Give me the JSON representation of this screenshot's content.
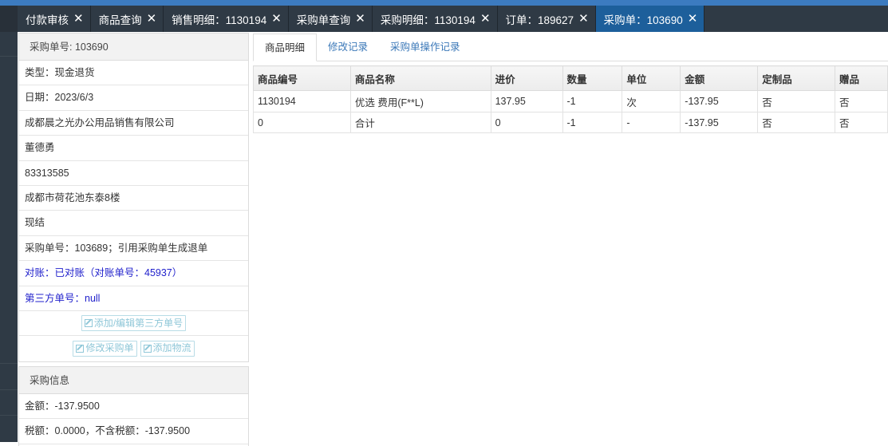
{
  "tabs": [
    {
      "label": "付款审核",
      "active": false
    },
    {
      "label": "商品查询",
      "active": false
    },
    {
      "label": "销售明细：1130194",
      "active": false
    },
    {
      "label": "采购单查询",
      "active": false
    },
    {
      "label": "采购明细：1130194",
      "active": false
    },
    {
      "label": "订单：189627",
      "active": false
    },
    {
      "label": "采购单：103690",
      "active": true
    }
  ],
  "order_panel": {
    "header": "采购单号: 103690",
    "type": "类型：现金退货",
    "date": "日期：2023/6/3",
    "supplier": "成都晨之光办公用品销售有限公司",
    "contact": "董德勇",
    "phone": "83313585",
    "address": "成都市荷花池东泰8楼",
    "payment": "现结",
    "reference": "采购单号：103689；引用采购单生成退单",
    "reconcile": "对账：已对账（对账单号：45937）",
    "third_party": "第三方单号：null",
    "btn_third_party": "添加/编辑第三方单号",
    "btn_edit_order": "修改采购单",
    "btn_add_logistics": "添加物流"
  },
  "purchase_info": {
    "header": "采购信息",
    "amount": "金额：-137.9500",
    "tax": "税额：0.0000，不含税额：-137.9500"
  },
  "subtabs": [
    {
      "label": "商品明细",
      "active": true
    },
    {
      "label": "修改记录",
      "active": false
    },
    {
      "label": "采购单操作记录",
      "active": false
    }
  ],
  "table": {
    "headers": [
      "商品编号",
      "商品名称",
      "进价",
      "数量",
      "单位",
      "金额",
      "定制品",
      "赠品"
    ],
    "rows": [
      [
        "1130194",
        "优选 费用(F**L)",
        "137.95",
        "-1",
        "次",
        "-137.95",
        "否",
        "否"
      ],
      [
        "0",
        "合计",
        "0",
        "-1",
        "-",
        "-137.95",
        "否",
        "否"
      ]
    ]
  },
  "colors": {
    "tabbar": "#2f3a45",
    "tab_active": "#1d5f9b",
    "topbar": "#3c7bc0",
    "link": "#2222cc"
  }
}
